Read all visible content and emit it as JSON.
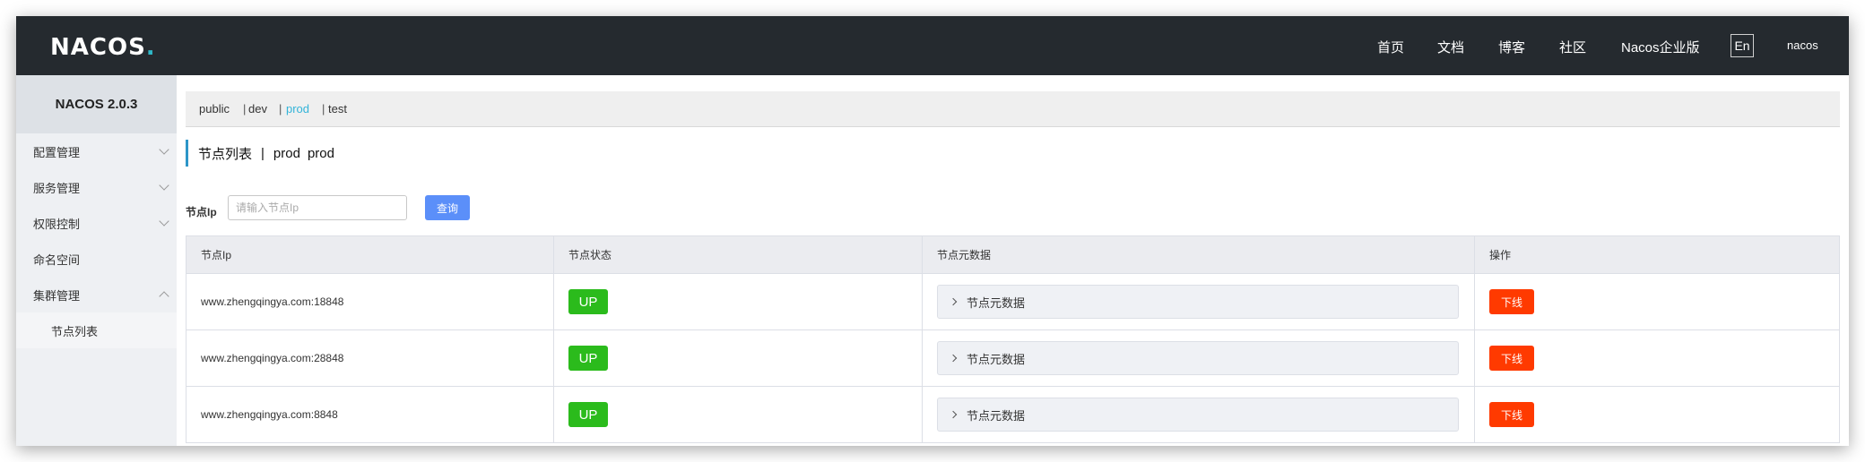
{
  "header": {
    "logo_text": "NACOS",
    "logo_dot": ".",
    "nav": [
      "首页",
      "文档",
      "博客",
      "社区",
      "Nacos企业版"
    ],
    "lang_button": "En",
    "user": "nacos"
  },
  "sidebar": {
    "title": "NACOS 2.0.3",
    "items": [
      {
        "label": "配置管理",
        "expandable": true
      },
      {
        "label": "服务管理",
        "expandable": true
      },
      {
        "label": "权限控制",
        "expandable": true
      },
      {
        "label": "命名空间",
        "expandable": false
      },
      {
        "label": "集群管理",
        "expandable": true,
        "expanded": true
      }
    ],
    "sub_items": [
      {
        "label": "节点列表"
      }
    ]
  },
  "namespaces": {
    "items": [
      "public",
      "dev",
      "prod",
      "test"
    ],
    "separator": "|",
    "active": "prod"
  },
  "page": {
    "title": "节点列表",
    "title_sep": "|",
    "title_ns_1": "prod",
    "title_ns_2": "prod"
  },
  "filter": {
    "label": "节点Ip",
    "placeholder": "请输入节点Ip",
    "query_button": "查询"
  },
  "table": {
    "columns": [
      "节点Ip",
      "节点状态",
      "节点元数据",
      "操作"
    ],
    "rows": [
      {
        "ip": "www.zhengqingya.com:18848",
        "status": "UP",
        "metadata": "节点元数据",
        "action": "下线"
      },
      {
        "ip": "www.zhengqingya.com:28848",
        "status": "UP",
        "metadata": "节点元数据",
        "action": "下线"
      },
      {
        "ip": "www.zhengqingya.com:8848",
        "status": "UP",
        "metadata": "节点元数据",
        "action": "下线"
      }
    ]
  },
  "colors": {
    "header_bg": "#252a2f",
    "accent": "#2fb7c7",
    "up_badge": "#2bbb1c",
    "offline_button": "#ff3a00",
    "query_button": "#5b8ff9"
  }
}
